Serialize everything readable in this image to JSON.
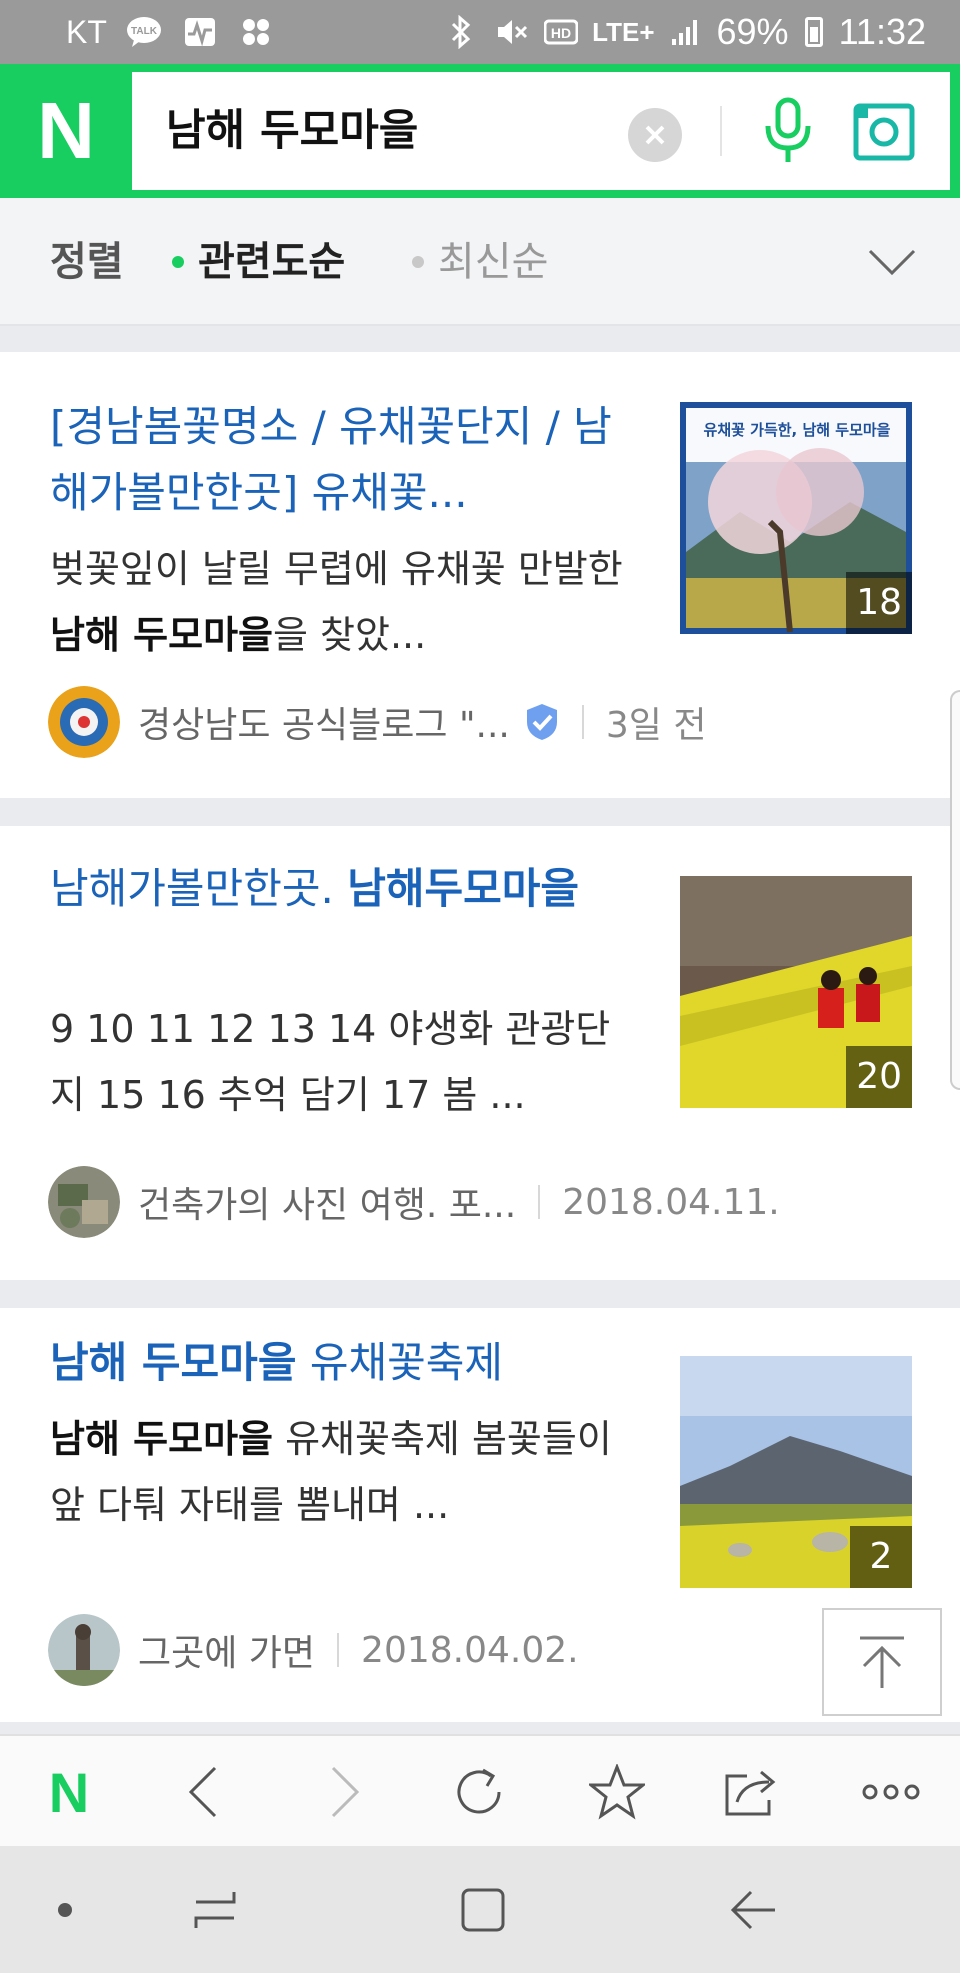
{
  "status_bar": {
    "carrier": "KT",
    "network": "LTE+",
    "battery": "69%",
    "time": "11:32",
    "icons": [
      "talk-icon",
      "pulse-icon",
      "apps-icon",
      "bluetooth-icon",
      "mute-icon",
      "hd-icon",
      "signal-icon",
      "battery-icon"
    ]
  },
  "header": {
    "logo": "N",
    "query": "남해 두모마을",
    "brand_color": "#19ce60"
  },
  "sort": {
    "label": "정렬",
    "options": [
      {
        "label": "관련도순",
        "selected": true
      },
      {
        "label": "최신순",
        "selected": false
      }
    ]
  },
  "results": [
    {
      "title": "[경남봄꽃명소 / 유채꽃단지 / 남해가볼만한곳] 유채꽃...",
      "desc_pre": "벚꽃잎이 날릴 무렵에 유채꽃 만발한 ",
      "desc_bold": "남해 두모마을",
      "desc_post": "을 찾았...",
      "thumb_count": "18",
      "thumb_banner": "유채꽃 가득한, 남해 두모마을",
      "source": "경상남도 공식블로그 \"...",
      "date": "3일 전"
    },
    {
      "title_pre": "남해가볼만한곳. ",
      "title_bold": "남해두모마을",
      "desc": "9 10 11 12 13 14 야생화 관광단지 15 16 추억 담기 17 봄 ...",
      "thumb_count": "20",
      "source": "건축가의 사진 여행. 포...",
      "date": "2018.04.11."
    },
    {
      "title_bold": "남해 두모마을",
      "title_post": " 유채꽃축제",
      "desc_bold": "남해 두모마을",
      "desc_post": " 유채꽃축제 봄꽃들이 앞 다퉈 자태를 뽐내며 ...",
      "thumb_count": "2",
      "source": "그곳에 가면",
      "date": "2018.04.02."
    }
  ],
  "toolbar": {
    "logo": "N",
    "buttons": [
      "back-icon",
      "forward-icon",
      "refresh-icon",
      "star-icon",
      "share-icon",
      "more-icon"
    ]
  }
}
